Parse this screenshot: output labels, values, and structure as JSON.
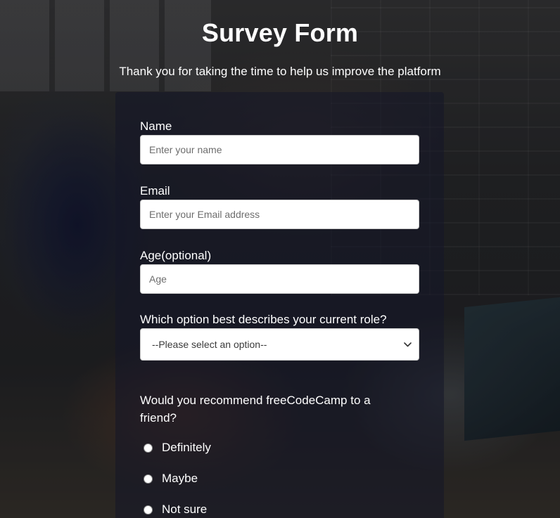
{
  "header": {
    "title": "Survey Form",
    "description": "Thank you for taking the time to help us improve the platform"
  },
  "form": {
    "name": {
      "label": "Name",
      "placeholder": "Enter your name",
      "value": ""
    },
    "email": {
      "label": "Email",
      "placeholder": "Enter your Email address",
      "value": ""
    },
    "age": {
      "label": "Age(optional)",
      "placeholder": "Age",
      "value": ""
    },
    "role": {
      "label": "Which option best describes your current role?",
      "selected": "--Please select an option--",
      "icon": "chevron-down-icon"
    },
    "recommend": {
      "question": "Would you recommend freeCodeCamp to a friend?",
      "options": [
        {
          "label": "Definitely",
          "checked": false
        },
        {
          "label": "Maybe",
          "checked": false
        },
        {
          "label": "Not sure",
          "checked": false
        }
      ]
    }
  },
  "colors": {
    "text": "#ffffff",
    "input_background": "#ffffff",
    "card_overlay": "#14162880"
  }
}
